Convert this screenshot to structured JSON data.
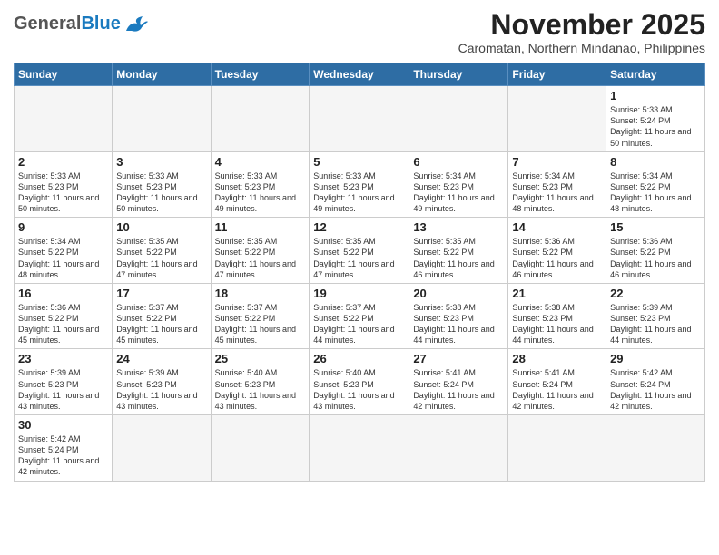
{
  "header": {
    "logo_general": "General",
    "logo_blue": "Blue",
    "month_title": "November 2025",
    "subtitle": "Caromatan, Northern Mindanao, Philippines"
  },
  "weekdays": [
    "Sunday",
    "Monday",
    "Tuesday",
    "Wednesday",
    "Thursday",
    "Friday",
    "Saturday"
  ],
  "weeks": [
    [
      {
        "day": "",
        "empty": true
      },
      {
        "day": "",
        "empty": true
      },
      {
        "day": "",
        "empty": true
      },
      {
        "day": "",
        "empty": true
      },
      {
        "day": "",
        "empty": true
      },
      {
        "day": "",
        "empty": true
      },
      {
        "day": "1",
        "sunrise": "5:33 AM",
        "sunset": "5:24 PM",
        "daylight": "11 hours and 50 minutes."
      }
    ],
    [
      {
        "day": "2",
        "sunrise": "5:33 AM",
        "sunset": "5:23 PM",
        "daylight": "11 hours and 50 minutes."
      },
      {
        "day": "3",
        "sunrise": "5:33 AM",
        "sunset": "5:23 PM",
        "daylight": "11 hours and 50 minutes."
      },
      {
        "day": "4",
        "sunrise": "5:33 AM",
        "sunset": "5:23 PM",
        "daylight": "11 hours and 49 minutes."
      },
      {
        "day": "5",
        "sunrise": "5:33 AM",
        "sunset": "5:23 PM",
        "daylight": "11 hours and 49 minutes."
      },
      {
        "day": "6",
        "sunrise": "5:34 AM",
        "sunset": "5:23 PM",
        "daylight": "11 hours and 49 minutes."
      },
      {
        "day": "7",
        "sunrise": "5:34 AM",
        "sunset": "5:23 PM",
        "daylight": "11 hours and 48 minutes."
      },
      {
        "day": "8",
        "sunrise": "5:34 AM",
        "sunset": "5:22 PM",
        "daylight": "11 hours and 48 minutes."
      }
    ],
    [
      {
        "day": "9",
        "sunrise": "5:34 AM",
        "sunset": "5:22 PM",
        "daylight": "11 hours and 48 minutes."
      },
      {
        "day": "10",
        "sunrise": "5:35 AM",
        "sunset": "5:22 PM",
        "daylight": "11 hours and 47 minutes."
      },
      {
        "day": "11",
        "sunrise": "5:35 AM",
        "sunset": "5:22 PM",
        "daylight": "11 hours and 47 minutes."
      },
      {
        "day": "12",
        "sunrise": "5:35 AM",
        "sunset": "5:22 PM",
        "daylight": "11 hours and 47 minutes."
      },
      {
        "day": "13",
        "sunrise": "5:35 AM",
        "sunset": "5:22 PM",
        "daylight": "11 hours and 46 minutes."
      },
      {
        "day": "14",
        "sunrise": "5:36 AM",
        "sunset": "5:22 PM",
        "daylight": "11 hours and 46 minutes."
      },
      {
        "day": "15",
        "sunrise": "5:36 AM",
        "sunset": "5:22 PM",
        "daylight": "11 hours and 46 minutes."
      }
    ],
    [
      {
        "day": "16",
        "sunrise": "5:36 AM",
        "sunset": "5:22 PM",
        "daylight": "11 hours and 45 minutes."
      },
      {
        "day": "17",
        "sunrise": "5:37 AM",
        "sunset": "5:22 PM",
        "daylight": "11 hours and 45 minutes."
      },
      {
        "day": "18",
        "sunrise": "5:37 AM",
        "sunset": "5:22 PM",
        "daylight": "11 hours and 45 minutes."
      },
      {
        "day": "19",
        "sunrise": "5:37 AM",
        "sunset": "5:22 PM",
        "daylight": "11 hours and 44 minutes."
      },
      {
        "day": "20",
        "sunrise": "5:38 AM",
        "sunset": "5:23 PM",
        "daylight": "11 hours and 44 minutes."
      },
      {
        "day": "21",
        "sunrise": "5:38 AM",
        "sunset": "5:23 PM",
        "daylight": "11 hours and 44 minutes."
      },
      {
        "day": "22",
        "sunrise": "5:39 AM",
        "sunset": "5:23 PM",
        "daylight": "11 hours and 44 minutes."
      }
    ],
    [
      {
        "day": "23",
        "sunrise": "5:39 AM",
        "sunset": "5:23 PM",
        "daylight": "11 hours and 43 minutes."
      },
      {
        "day": "24",
        "sunrise": "5:39 AM",
        "sunset": "5:23 PM",
        "daylight": "11 hours and 43 minutes."
      },
      {
        "day": "25",
        "sunrise": "5:40 AM",
        "sunset": "5:23 PM",
        "daylight": "11 hours and 43 minutes."
      },
      {
        "day": "26",
        "sunrise": "5:40 AM",
        "sunset": "5:23 PM",
        "daylight": "11 hours and 43 minutes."
      },
      {
        "day": "27",
        "sunrise": "5:41 AM",
        "sunset": "5:24 PM",
        "daylight": "11 hours and 42 minutes."
      },
      {
        "day": "28",
        "sunrise": "5:41 AM",
        "sunset": "5:24 PM",
        "daylight": "11 hours and 42 minutes."
      },
      {
        "day": "29",
        "sunrise": "5:42 AM",
        "sunset": "5:24 PM",
        "daylight": "11 hours and 42 minutes."
      }
    ],
    [
      {
        "day": "30",
        "sunrise": "5:42 AM",
        "sunset": "5:24 PM",
        "daylight": "11 hours and 42 minutes."
      },
      {
        "day": "",
        "empty": true
      },
      {
        "day": "",
        "empty": true
      },
      {
        "day": "",
        "empty": true
      },
      {
        "day": "",
        "empty": true
      },
      {
        "day": "",
        "empty": true
      },
      {
        "day": "",
        "empty": true
      }
    ]
  ],
  "labels": {
    "sunrise": "Sunrise:",
    "sunset": "Sunset:",
    "daylight": "Daylight:"
  }
}
